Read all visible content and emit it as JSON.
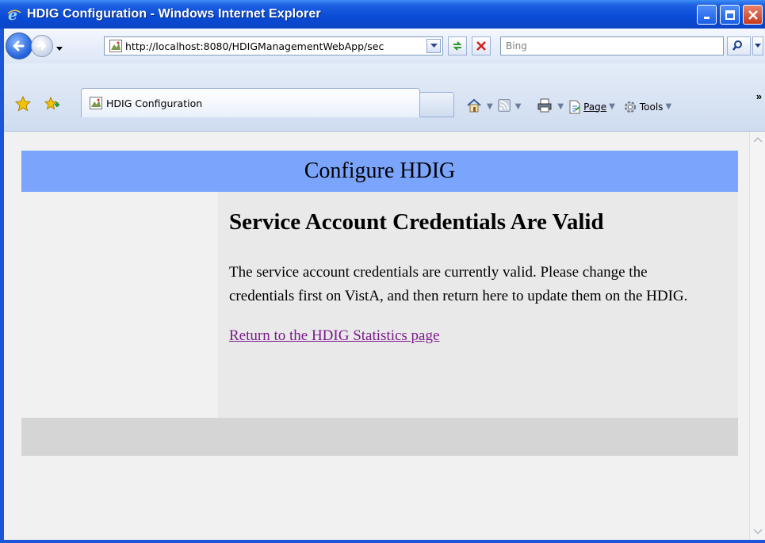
{
  "window": {
    "title": "HDIG Configuration - Windows Internet Explorer",
    "icon": "ie-logo-icon"
  },
  "nav": {
    "url": "http://localhost:8080/HDIGManagementWebApp/sec",
    "search_placeholder": "Bing"
  },
  "tabs": [
    {
      "label": "HDIG Configuration"
    }
  ],
  "commandbar": {
    "page_label": "Page",
    "tools_label": "Tools"
  },
  "page": {
    "header_title": "Configure HDIG",
    "heading": "Service Account Credentials Are Valid",
    "message": "The service account credentials are currently valid. Please change the credentials first on VistA, and then return here to update them on the HDIG.",
    "link_text": "Return to the HDIG Statistics page"
  },
  "colors": {
    "header_band": "#7ba5fd",
    "content_bg": "#e9e9e9",
    "footer_band": "#d5d5d5",
    "link": "#7a1a8a",
    "titlebar": "#0a4bd6"
  }
}
